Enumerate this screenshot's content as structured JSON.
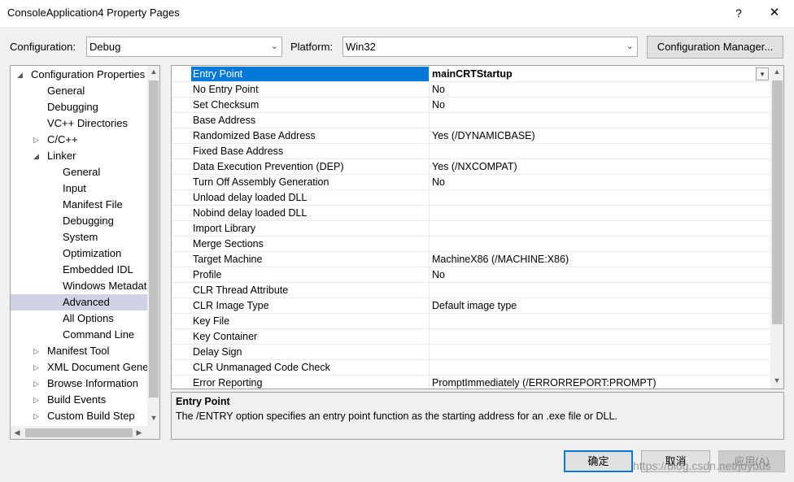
{
  "window": {
    "title": "ConsoleApplication4 Property Pages",
    "help": "?",
    "close": "✕"
  },
  "toolbar": {
    "configuration_label": "Configuration:",
    "configuration_value": "Debug",
    "platform_label": "Platform:",
    "platform_value": "Win32",
    "config_manager_label": "Configuration Manager..."
  },
  "tree": {
    "items": [
      {
        "label": "Configuration Properties",
        "level": 0,
        "toggle": "◢"
      },
      {
        "label": "General",
        "level": 1,
        "toggle": ""
      },
      {
        "label": "Debugging",
        "level": 1,
        "toggle": ""
      },
      {
        "label": "VC++ Directories",
        "level": 1,
        "toggle": ""
      },
      {
        "label": "C/C++",
        "level": 1,
        "toggle": "▷"
      },
      {
        "label": "Linker",
        "level": 1,
        "toggle": "◢"
      },
      {
        "label": "General",
        "level": 2,
        "toggle": ""
      },
      {
        "label": "Input",
        "level": 2,
        "toggle": ""
      },
      {
        "label": "Manifest File",
        "level": 2,
        "toggle": ""
      },
      {
        "label": "Debugging",
        "level": 2,
        "toggle": ""
      },
      {
        "label": "System",
        "level": 2,
        "toggle": ""
      },
      {
        "label": "Optimization",
        "level": 2,
        "toggle": ""
      },
      {
        "label": "Embedded IDL",
        "level": 2,
        "toggle": ""
      },
      {
        "label": "Windows Metadata",
        "level": 2,
        "toggle": ""
      },
      {
        "label": "Advanced",
        "level": 2,
        "toggle": ""
      },
      {
        "label": "All Options",
        "level": 2,
        "toggle": ""
      },
      {
        "label": "Command Line",
        "level": 2,
        "toggle": ""
      },
      {
        "label": "Manifest Tool",
        "level": 1,
        "toggle": "▷"
      },
      {
        "label": "XML Document Generator",
        "level": 1,
        "toggle": "▷"
      },
      {
        "label": "Browse Information",
        "level": 1,
        "toggle": "▷"
      },
      {
        "label": "Build Events",
        "level": 1,
        "toggle": "▷"
      },
      {
        "label": "Custom Build Step",
        "level": 1,
        "toggle": "▷"
      }
    ],
    "selected_index": 14
  },
  "properties": {
    "rows": [
      {
        "name": "Entry Point",
        "value": "mainCRTStartup"
      },
      {
        "name": "No Entry Point",
        "value": "No"
      },
      {
        "name": "Set Checksum",
        "value": "No"
      },
      {
        "name": "Base Address",
        "value": ""
      },
      {
        "name": "Randomized Base Address",
        "value": "Yes (/DYNAMICBASE)"
      },
      {
        "name": "Fixed Base Address",
        "value": ""
      },
      {
        "name": "Data Execution Prevention (DEP)",
        "value": "Yes (/NXCOMPAT)"
      },
      {
        "name": "Turn Off Assembly Generation",
        "value": "No"
      },
      {
        "name": "Unload delay loaded DLL",
        "value": ""
      },
      {
        "name": "Nobind delay loaded DLL",
        "value": ""
      },
      {
        "name": "Import Library",
        "value": ""
      },
      {
        "name": "Merge Sections",
        "value": ""
      },
      {
        "name": "Target Machine",
        "value": "MachineX86 (/MACHINE:X86)"
      },
      {
        "name": "Profile",
        "value": "No"
      },
      {
        "name": "CLR Thread Attribute",
        "value": ""
      },
      {
        "name": "CLR Image Type",
        "value": "Default image type"
      },
      {
        "name": "Key File",
        "value": ""
      },
      {
        "name": "Key Container",
        "value": ""
      },
      {
        "name": "Delay Sign",
        "value": ""
      },
      {
        "name": "CLR Unmanaged Code Check",
        "value": ""
      },
      {
        "name": "Error Reporting",
        "value": "PromptImmediately (/ERRORREPORT:PROMPT)"
      }
    ],
    "selected_index": 0
  },
  "description": {
    "title": "Entry Point",
    "text": "The /ENTRY option specifies an entry point function as the starting address for an .exe file or DLL."
  },
  "buttons": {
    "ok": "确定",
    "cancel": "取消",
    "apply": "应用(A)"
  },
  "watermark": "https://blog.csdn.net/joyous",
  "icons": {
    "dropdown": "▾",
    "scroll_up": "▲",
    "scroll_down": "▼",
    "scroll_left": "◀",
    "scroll_right": "▶",
    "combo_arrow": "⌄"
  },
  "colors": {
    "selection": "#0078d7",
    "tree_selection": "#cfd3e4"
  }
}
